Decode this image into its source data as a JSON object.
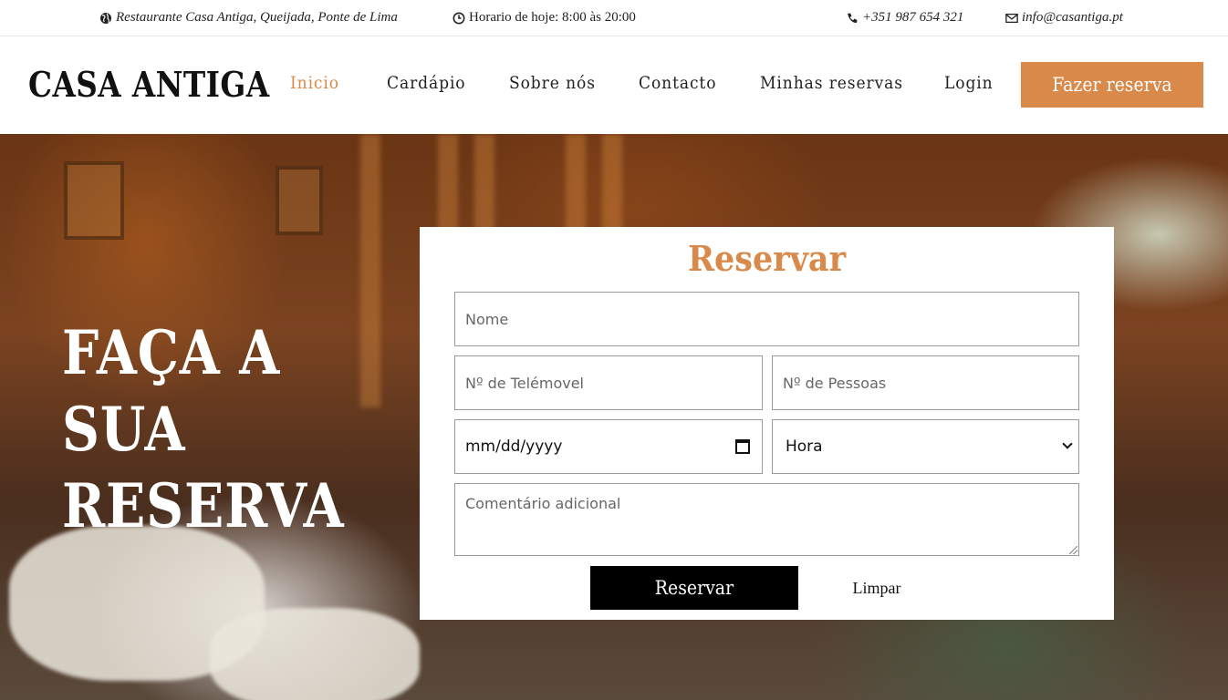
{
  "topbar": {
    "address": "Restaurante Casa Antiga, Queijada, Ponte de Lima",
    "hours": "Horario de hoje: 8:00 às 20:00",
    "phone": "+351 987 654 321",
    "email": "info@casantiga.pt",
    "icons": [
      "globe-icon",
      "clock-icon",
      "phone-icon",
      "envelope-icon"
    ]
  },
  "nav": {
    "logo": "CASA ANTIGA",
    "links": [
      "Inicio",
      "Cardápio",
      "Sobre nós",
      "Contacto",
      "Minhas reservas",
      "Login"
    ],
    "active": "Inicio",
    "cta": "Fazer reserva"
  },
  "hero": {
    "title_lines": [
      "FAÇA A",
      "SUA",
      "RESERVA"
    ]
  },
  "form": {
    "title": "Reservar",
    "name_placeholder": "Nome",
    "phone_placeholder": "Nº de Telémovel",
    "people_placeholder": "Nº de Pessoas",
    "date_value": "mm/dd/yyyy",
    "time_selected": "Hora",
    "comment_placeholder": "Comentário adicional",
    "submit_label": "Reservar",
    "clear_label": "Limpar"
  },
  "colors": {
    "accent": "#d9894a",
    "dark": "#000000",
    "text": "#222222"
  }
}
